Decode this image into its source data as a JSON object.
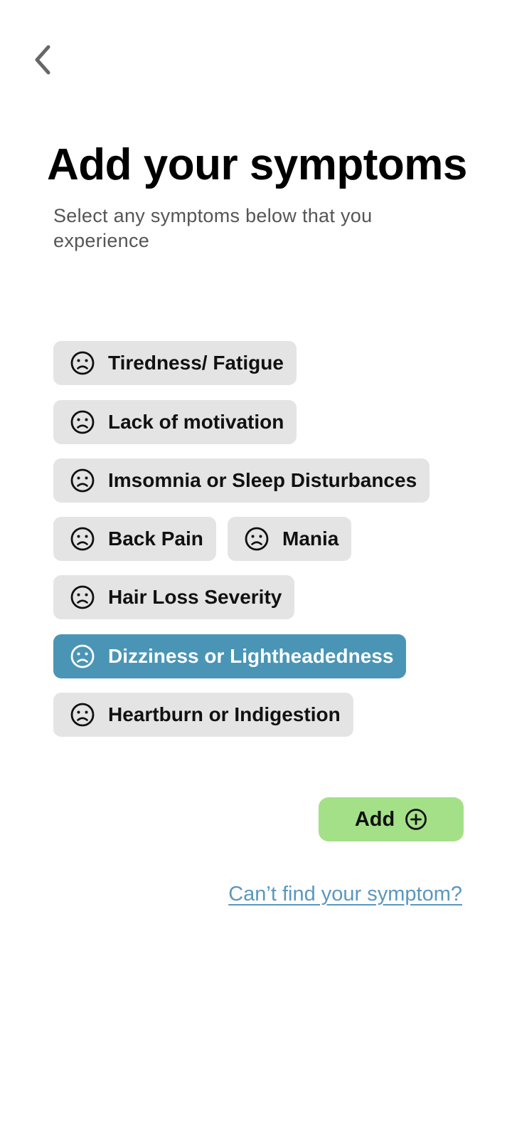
{
  "header": {
    "back_icon": "chevron-left-icon",
    "title": "Add your symptoms",
    "subtitle": "Select any symptoms below that you experience"
  },
  "symptoms": [
    {
      "label": "Tiredness/ Fatigue",
      "icon": "sad-face-icon",
      "selected": false
    },
    {
      "label": "Lack of motivation",
      "icon": "sad-face-icon",
      "selected": false
    },
    {
      "label": "Imsomnia or Sleep Disturbances",
      "icon": "sad-face-icon",
      "selected": false
    },
    {
      "label": "Back Pain",
      "icon": "sad-face-icon",
      "selected": false
    },
    {
      "label": "Mania",
      "icon": "sad-face-icon",
      "selected": false
    },
    {
      "label": "Hair Loss Severity",
      "icon": "sad-face-icon",
      "selected": false
    },
    {
      "label": "Dizziness or Lightheadedness",
      "icon": "sad-face-icon",
      "selected": true
    },
    {
      "label": "Heartburn or Indigestion",
      "icon": "sad-face-icon",
      "selected": false
    }
  ],
  "actions": {
    "add_label": "Add",
    "add_icon": "plus-circle-icon",
    "cant_find_label": "Can’t find your symptom?"
  },
  "colors": {
    "chip_background": "#e4e4e4",
    "chip_selected_background": "#4a95b6",
    "add_button_background": "#a3e088",
    "link_color": "#5b97bf"
  }
}
